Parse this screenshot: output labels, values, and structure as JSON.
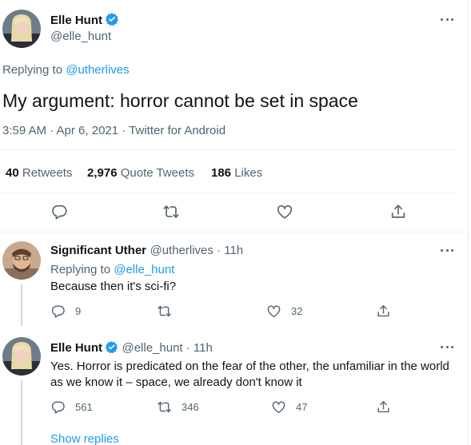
{
  "main_tweet": {
    "author_name": "Elle Hunt",
    "handle": "@elle_hunt",
    "replying_prefix": "Replying to ",
    "replying_to": "@utherlives",
    "text": "My argument: horror cannot be set in space",
    "timestamp": "3:59 AM · Apr 6, 2021 · Twitter for Android",
    "stats": {
      "retweets_count": "40",
      "retweets_label": "Retweets",
      "quotes_count": "2,976",
      "quotes_label": "Quote Tweets",
      "likes_count": "186",
      "likes_label": "Likes"
    }
  },
  "replies": [
    {
      "author_name": "Significant Uther",
      "handle_time": "@utherlives · 11h",
      "replying_prefix": "Replying to ",
      "replying_to": "@elle_hunt",
      "text": "Because then it's sci-fi?",
      "reply_count": "9",
      "retweet_count": "",
      "like_count": "32"
    },
    {
      "author_name": "Elle Hunt",
      "handle_time": "@elle_hunt · 11h",
      "text": "Yes. Horror is predicated on the fear of the other, the unfamiliar in the world as we know it – space, we already don't know it",
      "reply_count": "561",
      "retweet_count": "346",
      "like_count": "47"
    }
  ],
  "show_replies": "Show replies",
  "icons": [
    "more-icon",
    "verified-icon",
    "reply-icon",
    "retweet-icon",
    "like-icon",
    "share-icon"
  ],
  "colors": {
    "accent": "#1d9bf0",
    "text": "#0f1419",
    "muted": "#536471",
    "divider": "#eff3f4"
  }
}
